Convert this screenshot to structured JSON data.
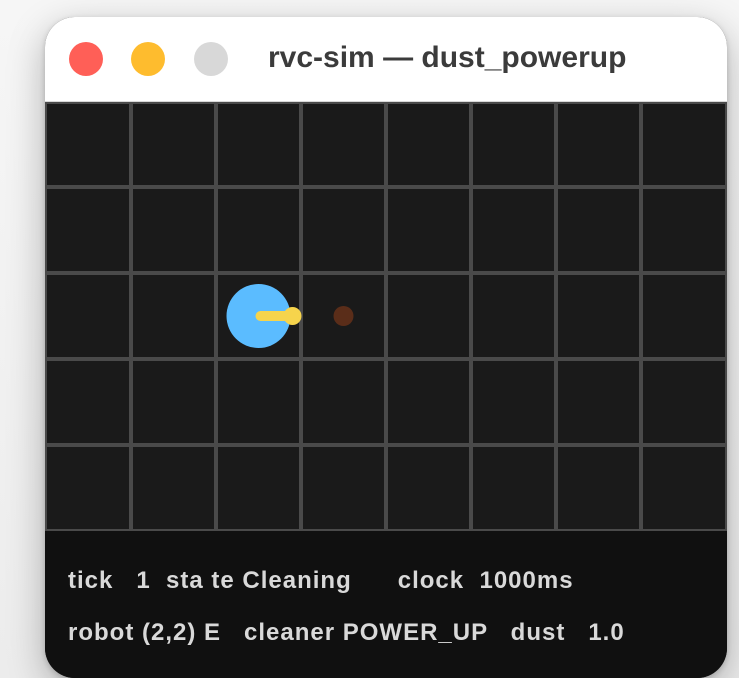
{
  "window": {
    "title": "rvc-sim — dust_powerup"
  },
  "simulation": {
    "grid_cols": 8,
    "grid_rows": 5,
    "robot": {
      "cell": [
        2,
        2
      ],
      "heading": "E",
      "color": "#5bbcff",
      "direction_color": "#f6d44c"
    },
    "dust_particle": {
      "cell": [
        3,
        2
      ],
      "color": "#5a2d19"
    },
    "colors": {
      "grid_background": "#1a1a1a",
      "grid_line": "#4a4a4a"
    }
  },
  "hud": {
    "line1": "tick   1  sta te Cleaning      clock  1000ms",
    "line2": "robot (2,2) E   cleaner POWER_UP   dust   1.0"
  }
}
